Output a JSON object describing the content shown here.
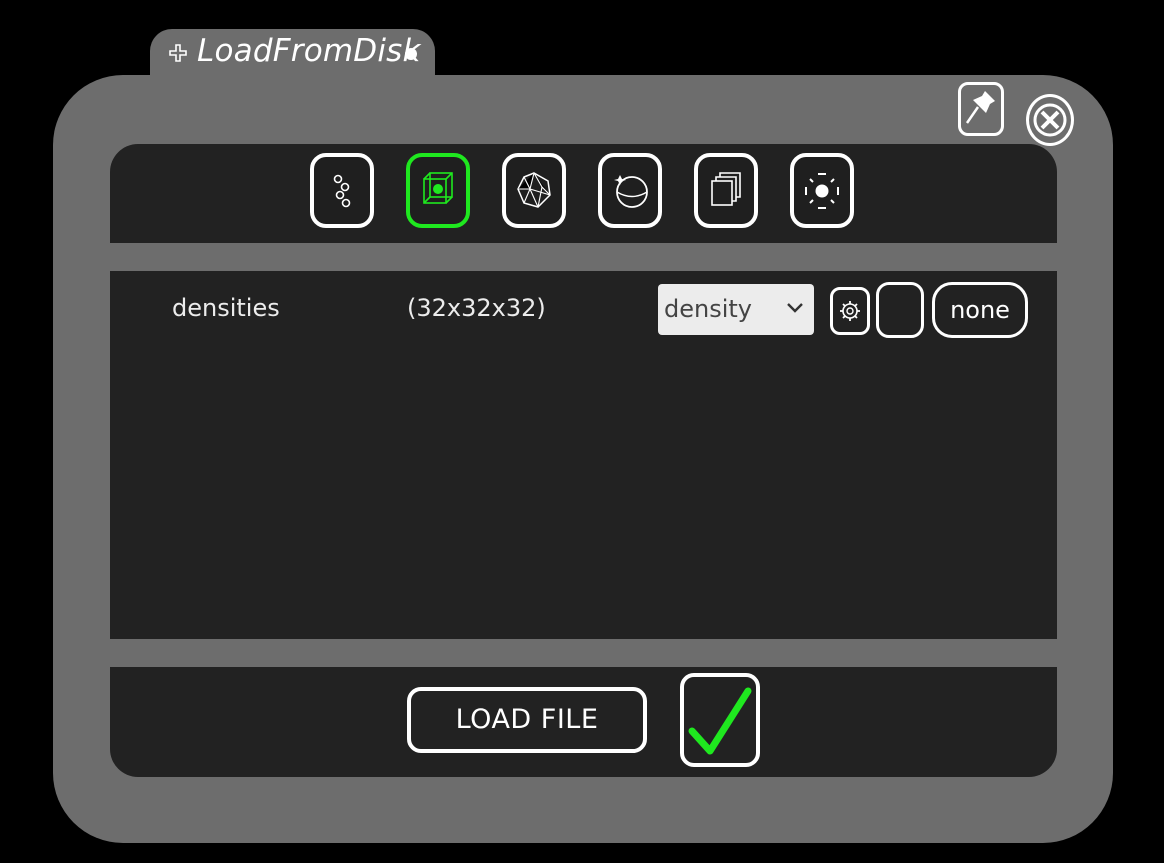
{
  "panel": {
    "title": "LoadFromDisk",
    "accent_color": "#1fe81f",
    "background_color": "#6d6d6d"
  },
  "toolbar": {
    "items": [
      {
        "icon": "particles-icon",
        "active": false
      },
      {
        "icon": "volume-cube-icon",
        "active": true
      },
      {
        "icon": "mesh-icon",
        "active": false
      },
      {
        "icon": "sphere-icon",
        "active": false
      },
      {
        "icon": "layers-icon",
        "active": false
      },
      {
        "icon": "cluster-icon",
        "active": false
      }
    ]
  },
  "field_row": {
    "name": "densities",
    "dimensions": "(32x32x32)",
    "select_value": "density",
    "none_label": "none"
  },
  "footer": {
    "load_label": "LOAD FILE"
  }
}
